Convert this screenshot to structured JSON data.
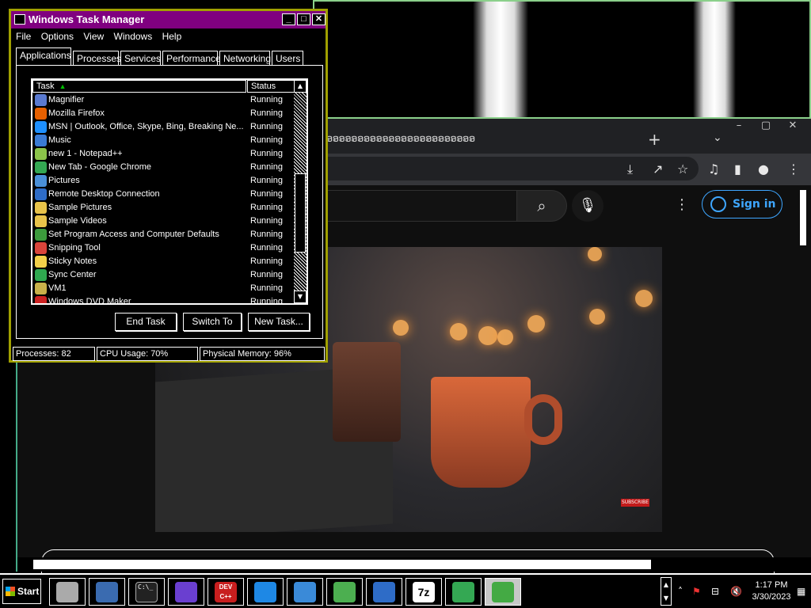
{
  "task_manager": {
    "title": "Windows Task Manager",
    "menu": [
      "File",
      "Options",
      "View",
      "Windows",
      "Help"
    ],
    "tabs": [
      "Applications",
      "Processes",
      "Services",
      "Performance",
      "Networking",
      "Users"
    ],
    "columns": {
      "task": "Task",
      "status": "Status"
    },
    "rows": [
      {
        "name": "Magnifier",
        "status": "Running",
        "color": "#5a7ad0"
      },
      {
        "name": "Mozilla Firefox",
        "status": "Running",
        "color": "#e66000"
      },
      {
        "name": "MSN | Outlook, Office, Skype, Bing, Breaking Ne...",
        "status": "Running",
        "color": "#1e90ff"
      },
      {
        "name": "Music",
        "status": "Running",
        "color": "#3a7bd5"
      },
      {
        "name": "new 1 - Notepad++",
        "status": "Running",
        "color": "#8bc34a"
      },
      {
        "name": "New Tab - Google Chrome",
        "status": "Running",
        "color": "#34a853"
      },
      {
        "name": "Pictures",
        "status": "Running",
        "color": "#4a90d9"
      },
      {
        "name": "Remote Desktop Connection",
        "status": "Running",
        "color": "#2e6cc7"
      },
      {
        "name": "Sample Pictures",
        "status": "Running",
        "color": "#e8c34a"
      },
      {
        "name": "Sample Videos",
        "status": "Running",
        "color": "#e8c34a"
      },
      {
        "name": "Set Program Access and Computer Defaults",
        "status": "Running",
        "color": "#3c9a3c"
      },
      {
        "name": "Snipping Tool",
        "status": "Running",
        "color": "#d9453b"
      },
      {
        "name": "Sticky Notes",
        "status": "Running",
        "color": "#f2d04a"
      },
      {
        "name": "Sync Center",
        "status": "Running",
        "color": "#2fa84f"
      },
      {
        "name": "VM1",
        "status": "Running",
        "color": "#c9b14a"
      },
      {
        "name": "Windows DVD Maker",
        "status": "Running",
        "color": "#cc2222"
      }
    ],
    "buttons": {
      "end_task": "End Task",
      "switch_to": "Switch To",
      "new_task": "New Task..."
    },
    "status": {
      "processes": "Processes: 82",
      "cpu": "CPU Usage: 70%",
      "memory": "Physical Memory: 96%"
    }
  },
  "browser": {
    "tabs_strip": "ອອອອອອອອອອອອອອອອອອອອອອອອ",
    "new_tab": "+",
    "window_controls": [
      "–",
      "▢",
      "✕"
    ],
    "youtube": {
      "sign_in": "Sign in",
      "subscribe": "SUBSCRIBE"
    }
  },
  "taskbar": {
    "start_label": "Start",
    "apps": [
      {
        "name": "printer",
        "color": "#aaaaaa"
      },
      {
        "name": "pictures",
        "color": "#3a6bb0"
      },
      {
        "name": "cmd",
        "color": "#222222"
      },
      {
        "name": "visual-studio",
        "color": "#6a3fd0"
      },
      {
        "name": "dev-cpp",
        "color": "#c81e1e"
      },
      {
        "name": "internet-explorer",
        "color": "#1e88e5"
      },
      {
        "name": "wmp",
        "color": "#3a8ad8"
      },
      {
        "name": "windows",
        "color": "#4caf50"
      },
      {
        "name": "remote-desktop",
        "color": "#2e6cc7"
      },
      {
        "name": "7zip",
        "color": "#ffffff"
      },
      {
        "name": "chrome",
        "color": "#34a853"
      },
      {
        "name": "task-manager",
        "color": "#44aa44"
      }
    ],
    "dev_cpp_text": "DEV C++",
    "seven_zip_text": "7z",
    "cmd_text": "C:\\_",
    "time": "1:17 PM",
    "date": "3/30/2023"
  }
}
